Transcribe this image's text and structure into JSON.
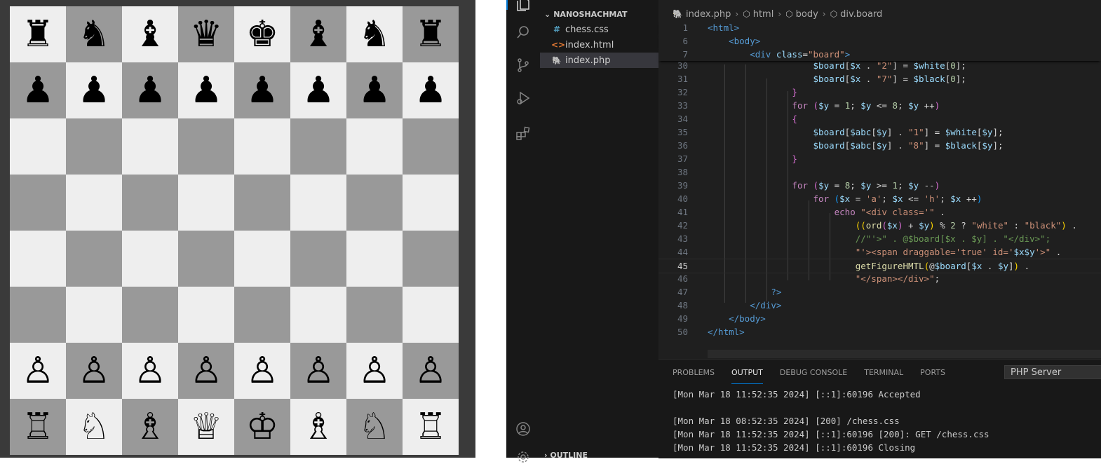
{
  "board": {
    "white_square_color": "#eeeeee",
    "black_square_color": "#999999",
    "ranks": [
      [
        "♜",
        "♞",
        "♝",
        "♛",
        "♚",
        "♝",
        "♞",
        "♜"
      ],
      [
        "♟",
        "♟",
        "♟",
        "♟",
        "♟",
        "♟",
        "♟",
        "♟"
      ],
      [
        "",
        "",
        "",
        "",
        "",
        "",
        "",
        ""
      ],
      [
        "",
        "",
        "",
        "",
        "",
        "",
        "",
        ""
      ],
      [
        "",
        "",
        "",
        "",
        "",
        "",
        "",
        ""
      ],
      [
        "",
        "",
        "",
        "",
        "",
        "",
        "",
        ""
      ],
      [
        "♙",
        "♙",
        "♙",
        "♙",
        "♙",
        "♙",
        "♙",
        "♙"
      ],
      [
        "♖",
        "♘",
        "♗",
        "♕",
        "♔",
        "♗",
        "♘",
        "♖"
      ]
    ]
  },
  "sidebar": {
    "explorer_title": "NANOSHACHMAT",
    "files": [
      {
        "icon": "#",
        "name": "chess.css",
        "color": "#519aba",
        "selected": false
      },
      {
        "icon": "<>",
        "name": "index.html",
        "color": "#e37933",
        "selected": false
      },
      {
        "icon": "php",
        "name": "index.php",
        "color": "#a074c4",
        "selected": true
      }
    ],
    "outline_title": "OUTLINE"
  },
  "breadcrumb": [
    "index.php",
    "html",
    "body",
    "div.board"
  ],
  "code": {
    "sticky": [
      {
        "ln": "1",
        "html": "<span class=\"t\">&lt;html&gt;</span>"
      },
      {
        "ln": "6",
        "html": "    <span class=\"t\">&lt;body&gt;</span>"
      },
      {
        "ln": "7",
        "html": "        <span class=\"t\">&lt;div</span> <span class=\"a\">class</span>=<span class=\"s\">\"board\"</span><span class=\"t\">&gt;</span>"
      }
    ],
    "lines": [
      {
        "ln": "30",
        "html": "                    <span class=\"v\">$board</span>[<span class=\"v\">$x</span> . <span class=\"s\">\"2\"</span>] = <span class=\"v\">$white</span>[<span class=\"n\">0</span>];"
      },
      {
        "ln": "31",
        "html": "                    <span class=\"v\">$board</span>[<span class=\"v\">$x</span> . <span class=\"s\">\"7\"</span>] = <span class=\"v\">$black</span>[<span class=\"n\">0</span>];"
      },
      {
        "ln": "32",
        "html": "                <span class=\"p2\">}</span>"
      },
      {
        "ln": "33",
        "html": "                <span class=\"k\">for</span> <span class=\"p2\">(</span><span class=\"v\">$y</span> = <span class=\"n\">1</span>; <span class=\"v\">$y</span> &lt;= <span class=\"n\">8</span>; <span class=\"v\">$y</span> ++<span class=\"p2\">)</span>"
      },
      {
        "ln": "34",
        "html": "                <span class=\"p2\">{</span>"
      },
      {
        "ln": "35",
        "html": "                    <span class=\"v\">$board</span>[<span class=\"v\">$abc</span>[<span class=\"v\">$y</span>] . <span class=\"s\">\"1\"</span>] = <span class=\"v\">$white</span>[<span class=\"v\">$y</span>];"
      },
      {
        "ln": "36",
        "html": "                    <span class=\"v\">$board</span>[<span class=\"v\">$abc</span>[<span class=\"v\">$y</span>] . <span class=\"s\">\"8\"</span>] = <span class=\"v\">$black</span>[<span class=\"v\">$y</span>];"
      },
      {
        "ln": "37",
        "html": "                <span class=\"p2\">}</span>"
      },
      {
        "ln": "38",
        "html": ""
      },
      {
        "ln": "39",
        "html": "                <span class=\"k\">for</span> <span class=\"p2\">(</span><span class=\"v\">$y</span> = <span class=\"n\">8</span>; <span class=\"v\">$y</span> &gt;= <span class=\"n\">1</span>; <span class=\"v\">$y</span> --<span class=\"p2\">)</span>"
      },
      {
        "ln": "40",
        "html": "                    <span class=\"k\">for</span> <span class=\"p3\">(</span><span class=\"v\">$x</span> = <span class=\"s\">'a'</span>; <span class=\"v\">$x</span> &lt;= <span class=\"s\">'h'</span>; <span class=\"v\">$x</span> ++<span class=\"p3\">)</span>"
      },
      {
        "ln": "41",
        "html": "                        <span class=\"k\">echo</span> <span class=\"s\">\"&lt;div class='\"</span> ."
      },
      {
        "ln": "42",
        "html": "                            <span class=\"p\">((</span><span class=\"f\">ord</span><span class=\"p2\">(</span><span class=\"v\">$x</span><span class=\"p2\">)</span> + <span class=\"v\">$y</span><span class=\"p\">)</span> % <span class=\"n\">2</span> ? <span class=\"s\">\"white\"</span> : <span class=\"s\">\"black\"</span><span class=\"p\">)</span> ."
      },
      {
        "ln": "43",
        "html": "                            <span class=\"c\">//\"'&gt;\" . @$board[$x . $y] . \"&lt;/div&gt;\";</span>"
      },
      {
        "ln": "44",
        "html": "                            <span class=\"s\">\"'&gt;&lt;span draggable='true' id='</span><span class=\"v\">$x$y</span><span class=\"s\">'&gt;\"</span> ."
      },
      {
        "ln": "45",
        "html": "                            <span class=\"f\">getFigureHMTL</span><span class=\"p\">(</span>@<span class=\"v\">$board</span>[<span class=\"v\">$x</span> . <span class=\"v\">$y</span>]<span class=\"p\">)</span> .",
        "active": true
      },
      {
        "ln": "46",
        "html": "                            <span class=\"s\">\"&lt;/span&gt;&lt;/div&gt;\"</span>;"
      },
      {
        "ln": "47",
        "html": "            <span class=\"t\">?&gt;</span>"
      },
      {
        "ln": "48",
        "html": "        <span class=\"t\">&lt;/div&gt;</span>"
      },
      {
        "ln": "49",
        "html": "    <span class=\"t\">&lt;/body&gt;</span>"
      },
      {
        "ln": "50",
        "html": "<span class=\"t\">&lt;/html&gt;</span>"
      }
    ]
  },
  "panel": {
    "tabs": [
      "PROBLEMS",
      "OUTPUT",
      "DEBUG CONSOLE",
      "TERMINAL",
      "PORTS"
    ],
    "active_tab": "OUTPUT",
    "server_select": "PHP Server",
    "log": [
      "[Mon Mar 18 11:52:35 2024] [::1]:60196 Accepted",
      "",
      "[Mon Mar 18 08:52:35 2024] [200] /chess.css",
      "[Mon Mar 18 11:52:35 2024] [::1]:60196 [200]: GET /chess.css",
      "[Mon Mar 18 11:52:35 2024] [::1]:60196 Closing"
    ]
  }
}
